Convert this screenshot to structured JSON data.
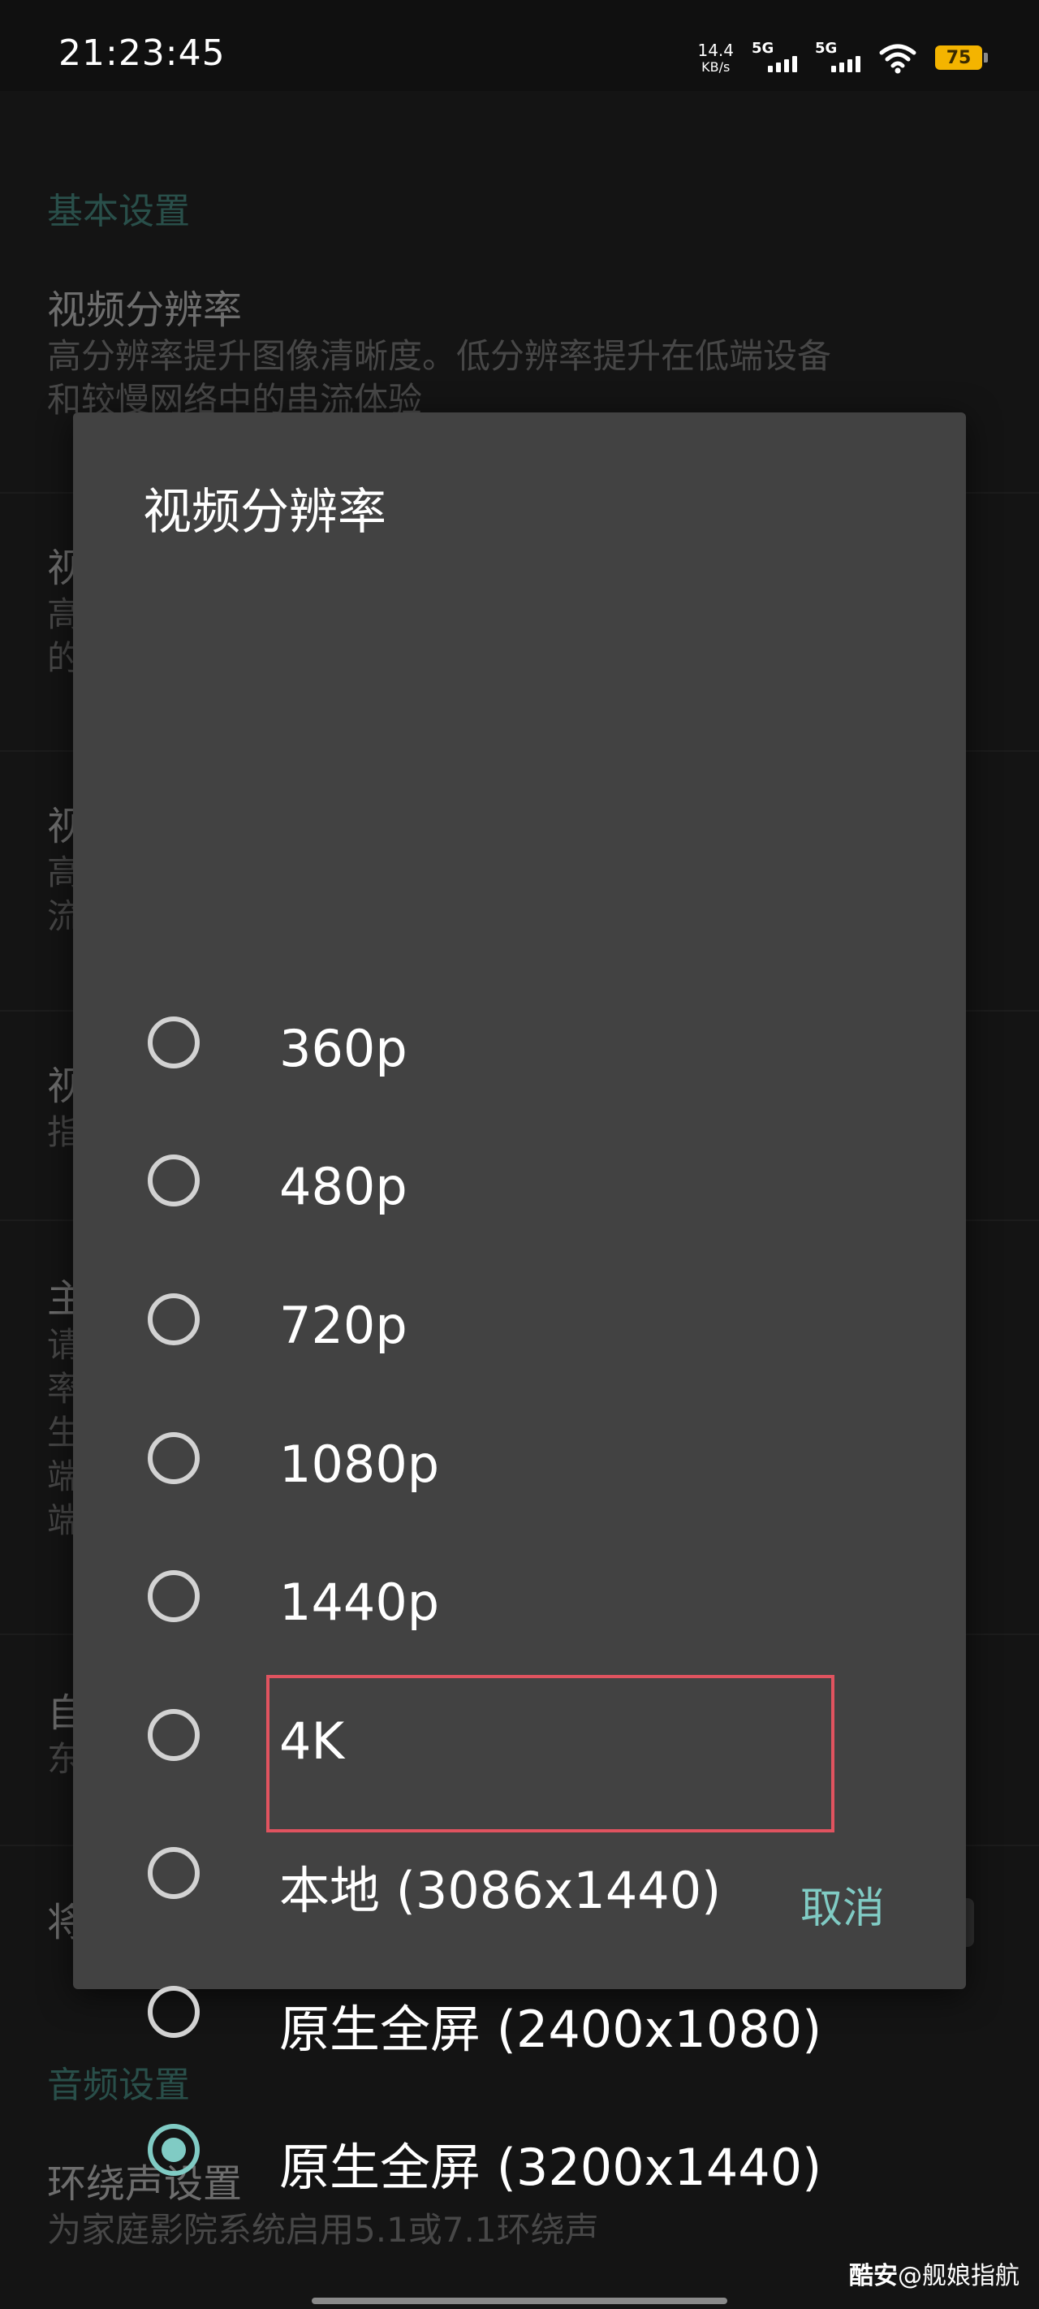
{
  "status_bar": {
    "time": "21:23:45",
    "net_speed_value": "14.4",
    "net_speed_unit": "KB/s",
    "signal_1_label": "5G",
    "signal_2_label": "5G",
    "battery": "75",
    "battery_color": "#f4b400",
    "icons": [
      "signal-icon",
      "signal-icon",
      "wifi-icon",
      "battery-icon"
    ]
  },
  "background": {
    "section_video": "基本设置",
    "items": [
      {
        "title": "视频分辨率",
        "desc_1": "高分辨率提升图像清晰度。低分辨率提升在低端设备",
        "desc_2": "和较慢网络中的串流体验"
      },
      {
        "title": "视",
        "desc_1": "高",
        "desc_2": "的"
      },
      {
        "title": "视",
        "desc_1": "高",
        "desc_2": "流"
      },
      {
        "title": "视",
        "desc_1": "指",
        "desc_2": ""
      },
      {
        "title": "主",
        "desc_1": "请",
        "desc_2": "率",
        "desc_3": "生",
        "desc_4": "端",
        "desc_5": "端"
      },
      {
        "title": "自",
        "desc_1": "东",
        "desc_2": ""
      },
      {
        "title": "将",
        "desc_1": "",
        "desc_2": ""
      }
    ],
    "section_audio": "音频设置",
    "audio_item": {
      "title": "环绕声设置",
      "desc": "为家庭影院系统启用5.1或7.1环绕声"
    },
    "accent_color": "#3f7a72"
  },
  "dialog": {
    "title": "视频分辨率",
    "options": [
      {
        "label": "360p",
        "checked": false
      },
      {
        "label": "480p",
        "checked": false
      },
      {
        "label": "720p",
        "checked": false
      },
      {
        "label": "1080p",
        "checked": false
      },
      {
        "label": "1440p",
        "checked": false
      },
      {
        "label": "4K",
        "checked": false
      },
      {
        "label": "本地 (3086x1440)",
        "checked": false
      },
      {
        "label": "原生全屏 (2400x1080)",
        "checked": false
      },
      {
        "label": "原生全屏 (3200x1440)",
        "checked": true
      }
    ],
    "cancel_label": "取消",
    "accent_color": "#80cbc4",
    "highlight_color": "#e0535f"
  },
  "watermark": {
    "brand": "酷安",
    "handle": "@舰娘指航"
  }
}
